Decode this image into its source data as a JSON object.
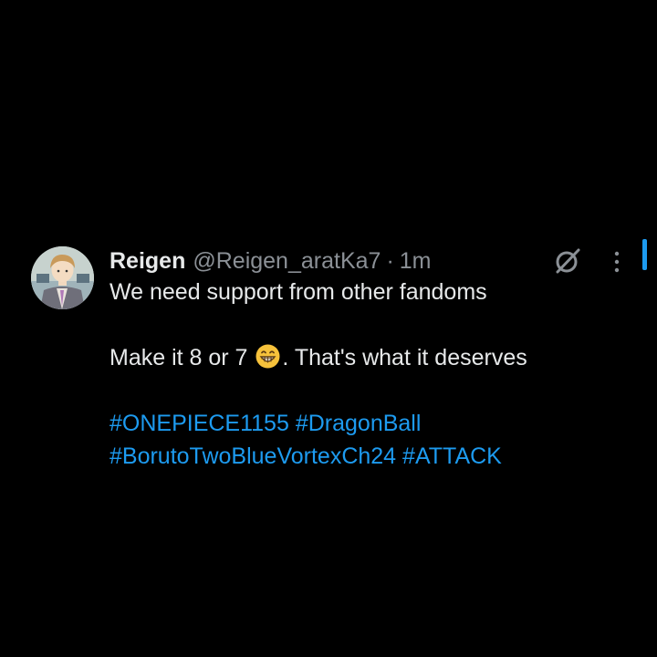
{
  "tweet": {
    "author_name": "Reigen",
    "author_handle": "@Reigen_aratKa7",
    "separator": "·",
    "timestamp": "1m",
    "text_line_1": "We need support from other fandoms",
    "text_line_2_before_emoji": "Make it 8 or 7",
    "emoji": "grinning-face-with-smiling-eyes",
    "text_line_2_after_emoji": ". That's what it deserves",
    "hashtags": [
      "#ONEPIECE1155",
      "#DragonBall",
      "#BorutoTwoBlueVortexCh24",
      "#ATTACK"
    ]
  },
  "icons": {
    "grok": "grok-icon",
    "more": "more-options-icon",
    "avatar": "avatar"
  },
  "colors": {
    "background": "#000000",
    "text_primary": "#e7e9ea",
    "text_secondary": "#8b9096",
    "link": "#1d9bf0"
  }
}
